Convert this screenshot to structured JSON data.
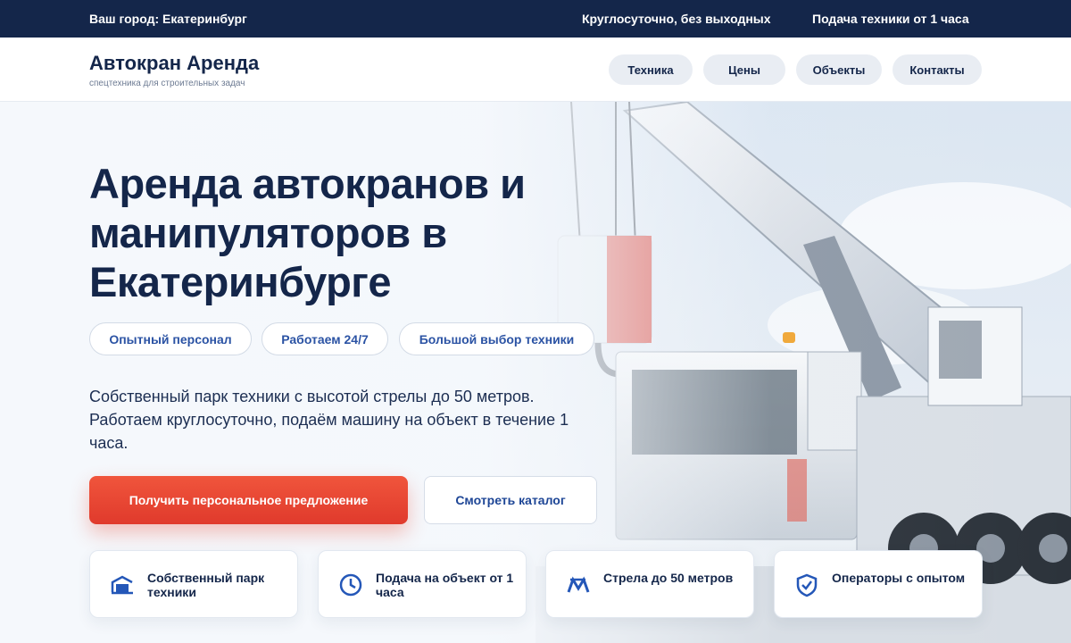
{
  "topbar": {
    "city": "Ваш город: Екатеринбург",
    "hours": "Круглосуточно, без выходных",
    "delivery": "Подача техники от 1 часа"
  },
  "header": {
    "logo_title": "Автокран Аренда",
    "logo_subtitle": "спецтехника для строительных задач",
    "nav": [
      "Техника",
      "Цены",
      "Объекты",
      "Контакты"
    ]
  },
  "hero": {
    "title": "Аренда автокранов и манипуляторов в Екатеринбурге",
    "pills": [
      "Опытный персонал",
      "Работаем 24/7",
      "Большой выбор техники"
    ],
    "description": "Собственный парк техники с высотой стрелы до 50 метров. Работаем круглосуточно, подаём машину на объект в течение 1 часа.",
    "primary_button": "Получить персональное предложение",
    "secondary_button": "Смотреть каталог"
  },
  "features": [
    {
      "icon": "garage-icon",
      "text": "Собственный парк техники"
    },
    {
      "icon": "clock-icon",
      "text": "Подача на объект от 1 часа"
    },
    {
      "icon": "boom-icon",
      "text": "Стрела до 50 метров"
    },
    {
      "icon": "shield-check-icon",
      "text": "Операторы с опытом"
    }
  ],
  "colors": {
    "navy": "#14264a",
    "accent_red": "#e8462f",
    "link_blue": "#2b53a4",
    "icon_blue": "#2457b8"
  }
}
